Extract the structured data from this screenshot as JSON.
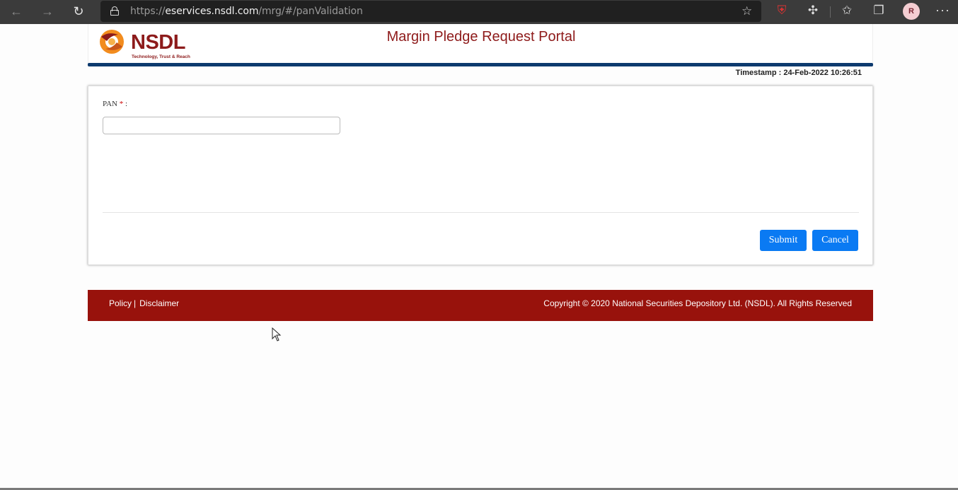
{
  "browser": {
    "url_prefix": "https://",
    "url_host": "eservices.nsdl.com",
    "url_path": "/mrg/#/panValidation",
    "avatar_initial": "R",
    "icons": [
      "back-arrow-icon",
      "forward-arrow-icon",
      "reload-icon",
      "lock-icon",
      "favorite-star-icon",
      "shield-icon",
      "puzzle-icon",
      "favorites-icon",
      "collections-icon",
      "more-icon"
    ]
  },
  "header": {
    "logo_text": "NSDL",
    "logo_tagline": "Technology, Trust & Reach",
    "title": "Margin Pledge Request Portal",
    "timestamp": "Timestamp : 24-Feb-2022 10:26:51"
  },
  "form": {
    "pan_label": "PAN",
    "pan_required_mark": "*",
    "pan_label_suffix": " :",
    "pan_value": "",
    "submit_label": "Submit",
    "cancel_label": "Cancel"
  },
  "footer": {
    "policy_link": "Policy",
    "link_separator": "|",
    "disclaimer_link": "Disclaimer",
    "copyright": "Copyright © 2020 National Securities Depository Ltd. (NSDL). All Rights Reserved"
  },
  "colors": {
    "brand_red": "#8e1a1a",
    "footer_bg": "#98120c",
    "header_bar": "#0d3a6e",
    "button_blue": "#0a7af3"
  }
}
